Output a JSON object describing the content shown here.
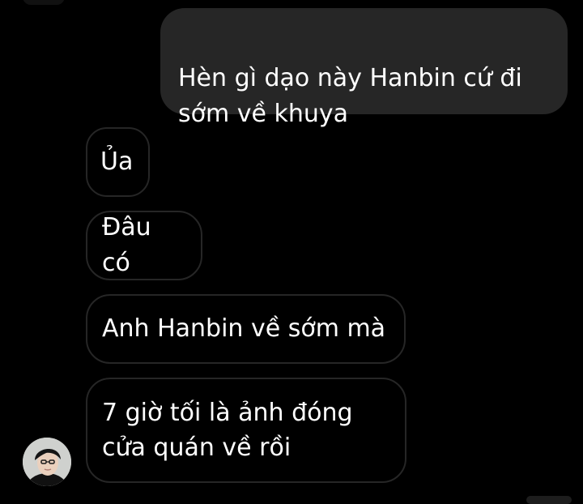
{
  "conversation": {
    "messages": [
      {
        "direction": "outgoing",
        "text": "Hèn gì dạo này Hanbin cứ đi\nsớm về khuya"
      },
      {
        "direction": "incoming",
        "text": "Ủa"
      },
      {
        "direction": "incoming",
        "text": "Đâu có"
      },
      {
        "direction": "incoming",
        "text": "Anh Hanbin về sớm mà"
      },
      {
        "direction": "incoming",
        "text": "7 giờ tối là ảnh đóng\ncửa quán về rồi"
      }
    ]
  },
  "colors": {
    "background": "#000000",
    "outgoing_bubble": "#262626",
    "incoming_border": "#262626",
    "text": "#ffffff"
  },
  "icons": {
    "avatar": "contact-avatar-photo"
  }
}
